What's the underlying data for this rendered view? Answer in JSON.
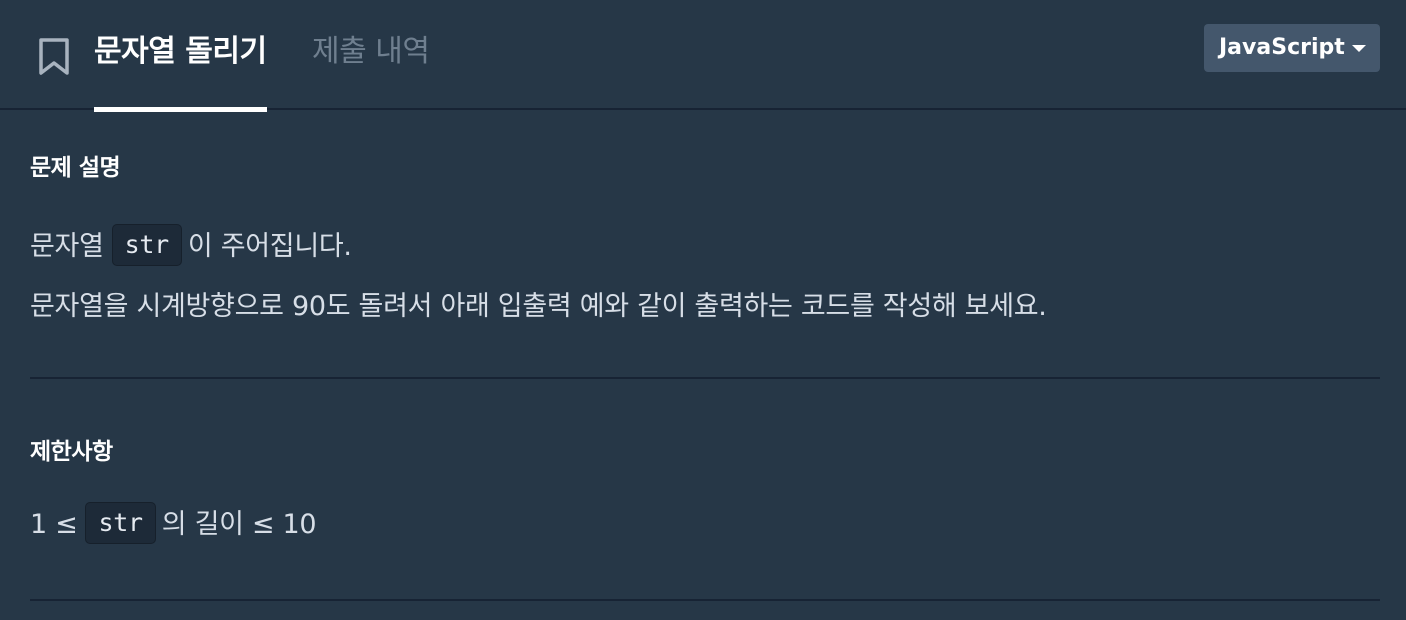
{
  "header": {
    "tabs": [
      {
        "label": "문자열 돌리기",
        "active": true
      },
      {
        "label": "제출 내역",
        "active": false
      }
    ],
    "language_select": {
      "value": "JavaScript"
    }
  },
  "description": {
    "title": "문제 설명",
    "line1": {
      "before": "문자열",
      "code": "str",
      "after": "이 주어집니다."
    },
    "line2": "문자열을 시계방향으로 90도 돌려서 아래 입출력 예와 같이 출력하는 코드를 작성해 보세요."
  },
  "constraints": {
    "title": "제한사항",
    "line1": {
      "before": "1 ≤",
      "code": "str",
      "after": "의 길이 ≤ 10"
    }
  },
  "colors": {
    "background": "#263747",
    "divider": "#172334",
    "select_bg": "#44576c",
    "code_bg": "#1d2a38"
  },
  "icons": {
    "bookmark": "bookmark-icon",
    "caret": "caret-down-icon"
  }
}
